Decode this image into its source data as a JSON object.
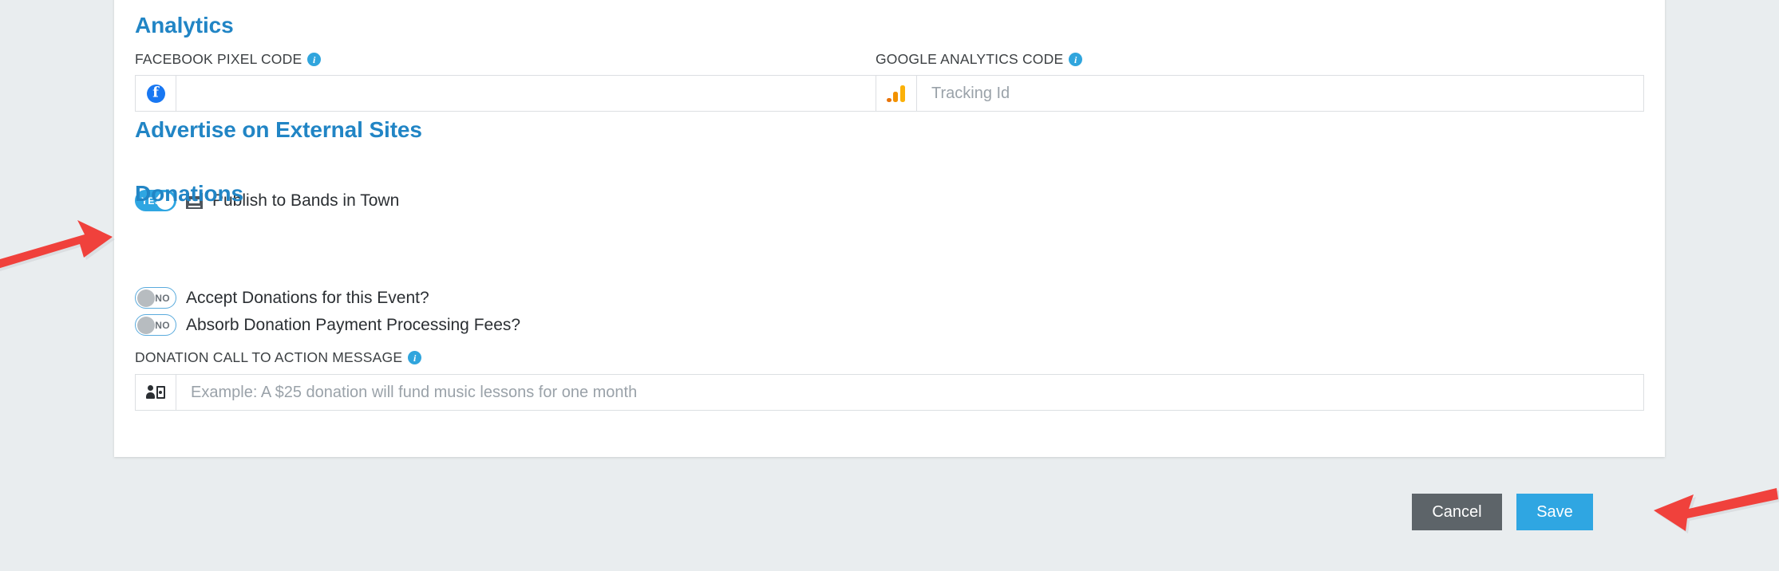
{
  "page": {
    "background_color": "#e9edef",
    "card_background": "#ffffff",
    "accent_color": "#2185c5",
    "toggle_on_color": "#2fa6e2",
    "arrow_color": "#f0413c"
  },
  "analytics": {
    "title": "Analytics",
    "facebook": {
      "label": "FACEBOOK PIXEL CODE",
      "info_icon": "info-icon",
      "addon_icon": "facebook-icon",
      "value": "",
      "placeholder": ""
    },
    "google": {
      "label": "GOOGLE ANALYTICS CODE",
      "info_icon": "info-icon",
      "addon_icon": "google-analytics-icon",
      "value": "",
      "placeholder": "Tracking Id"
    }
  },
  "advertise": {
    "title": "Advertise on External Sites",
    "publish_toggle": {
      "state_label": "YES",
      "state": "on",
      "icon": "venue-icon",
      "text": "Publish to Bands in Town"
    }
  },
  "donations": {
    "title": "Donations",
    "toggles": [
      {
        "state_label": "NO",
        "state": "off",
        "text": "Accept Donations for this Event?"
      },
      {
        "state_label": "NO",
        "state": "off",
        "text": "Absorb Donation Payment Processing Fees?"
      }
    ],
    "call_to_action": {
      "label": "DONATION CALL TO ACTION MESSAGE",
      "info_icon": "info-icon",
      "addon_icon": "donation-person-icon",
      "value": "",
      "placeholder": "Example: A $25 donation will fund music lessons for one month"
    }
  },
  "footer": {
    "cancel_label": "Cancel",
    "save_label": "Save"
  },
  "annotations": {
    "left_arrow": "arrow-pointing-right-to-publish-toggle",
    "right_arrow": "arrow-pointing-left-to-save-button"
  }
}
